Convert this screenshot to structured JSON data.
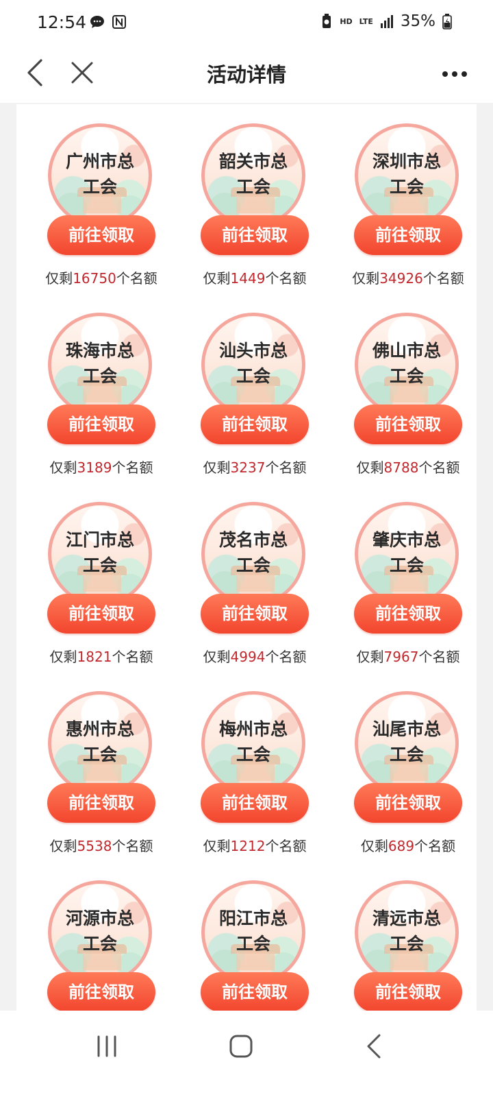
{
  "status_bar": {
    "time": "12:54",
    "network_hd": "HD",
    "network_lte": "LTE",
    "battery": "35%"
  },
  "nav": {
    "title": "活动详情"
  },
  "button_label": "前往领取",
  "quota_prefix": "仅剩",
  "quota_suffix": "个名额",
  "unions": [
    {
      "line1": "广州市总",
      "line2": "工会",
      "remaining": "16750"
    },
    {
      "line1": "韶关市总",
      "line2": "工会",
      "remaining": "1449"
    },
    {
      "line1": "深圳市总",
      "line2": "工会",
      "remaining": "34926"
    },
    {
      "line1": "珠海市总",
      "line2": "工会",
      "remaining": "3189"
    },
    {
      "line1": "汕头市总",
      "line2": "工会",
      "remaining": "3237"
    },
    {
      "line1": "佛山市总",
      "line2": "工会",
      "remaining": "8788"
    },
    {
      "line1": "江门市总",
      "line2": "工会",
      "remaining": "1821"
    },
    {
      "line1": "茂名市总",
      "line2": "工会",
      "remaining": "4994"
    },
    {
      "line1": "肇庆市总",
      "line2": "工会",
      "remaining": "7967"
    },
    {
      "line1": "惠州市总",
      "line2": "工会",
      "remaining": "5538"
    },
    {
      "line1": "梅州市总",
      "line2": "工会",
      "remaining": "1212"
    },
    {
      "line1": "汕尾市总",
      "line2": "工会",
      "remaining": "689"
    },
    {
      "line1": "河源市总",
      "line2": "工会",
      "remaining": ""
    },
    {
      "line1": "阳江市总",
      "line2": "工会",
      "remaining": ""
    },
    {
      "line1": "清远市总",
      "line2": "工会",
      "remaining": ""
    }
  ]
}
